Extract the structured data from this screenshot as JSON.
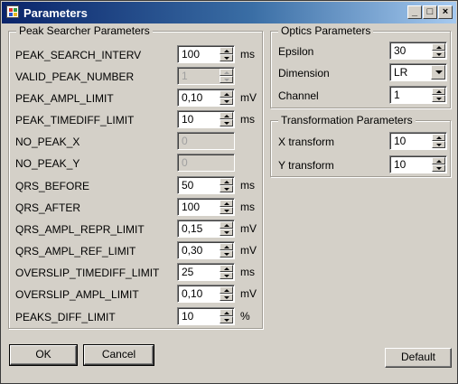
{
  "window": {
    "title": "Parameters"
  },
  "peak_searcher": {
    "title": "Peak Searcher Parameters",
    "rows": [
      {
        "label": "PEAK_SEARCH_INTERV",
        "value": "100",
        "unit": "ms",
        "enabled": true,
        "spinner": true
      },
      {
        "label": "VALID_PEAK_NUMBER",
        "value": "1",
        "unit": "",
        "enabled": false,
        "spinner": true
      },
      {
        "label": "PEAK_AMPL_LIMIT",
        "value": "0,10",
        "unit": "mV",
        "enabled": true,
        "spinner": true
      },
      {
        "label": "PEAK_TIMEDIFF_LIMIT",
        "value": "10",
        "unit": "ms",
        "enabled": true,
        "spinner": true
      },
      {
        "label": "NO_PEAK_X",
        "value": "0",
        "unit": "",
        "enabled": false,
        "spinner": false
      },
      {
        "label": "NO_PEAK_Y",
        "value": "0",
        "unit": "",
        "enabled": false,
        "spinner": false
      },
      {
        "label": "QRS_BEFORE",
        "value": "50",
        "unit": "ms",
        "enabled": true,
        "spinner": true
      },
      {
        "label": "QRS_AFTER",
        "value": "100",
        "unit": "ms",
        "enabled": true,
        "spinner": true
      },
      {
        "label": "QRS_AMPL_REPR_LIMIT",
        "value": "0,15",
        "unit": "mV",
        "enabled": true,
        "spinner": true
      },
      {
        "label": "QRS_AMPL_REF_LIMIT",
        "value": "0,30",
        "unit": "mV",
        "enabled": true,
        "spinner": true
      },
      {
        "label": "OVERSLIP_TIMEDIFF_LIMIT",
        "value": "25",
        "unit": "ms",
        "enabled": true,
        "spinner": true
      },
      {
        "label": "OVERSLIP_AMPL_LIMIT",
        "value": "0,10",
        "unit": "mV",
        "enabled": true,
        "spinner": true
      },
      {
        "label": "PEAKS_DIFF_LIMIT",
        "value": "10",
        "unit": "%",
        "enabled": true,
        "spinner": true
      }
    ]
  },
  "optics": {
    "title": "Optics Parameters",
    "epsilon": {
      "label": "Epsilon",
      "value": "30"
    },
    "dimension": {
      "label": "Dimension",
      "value": "LR"
    },
    "channel": {
      "label": "Channel",
      "value": "1"
    }
  },
  "transformation": {
    "title": "Transformation Parameters",
    "x": {
      "label": "X transform",
      "value": "10"
    },
    "y": {
      "label": "Y transform",
      "value": "10"
    }
  },
  "buttons": {
    "ok": "OK",
    "cancel": "Cancel",
    "default": "Default"
  },
  "titlebar_buttons": {
    "minimize": "_",
    "maximize": "□",
    "close": "×"
  }
}
